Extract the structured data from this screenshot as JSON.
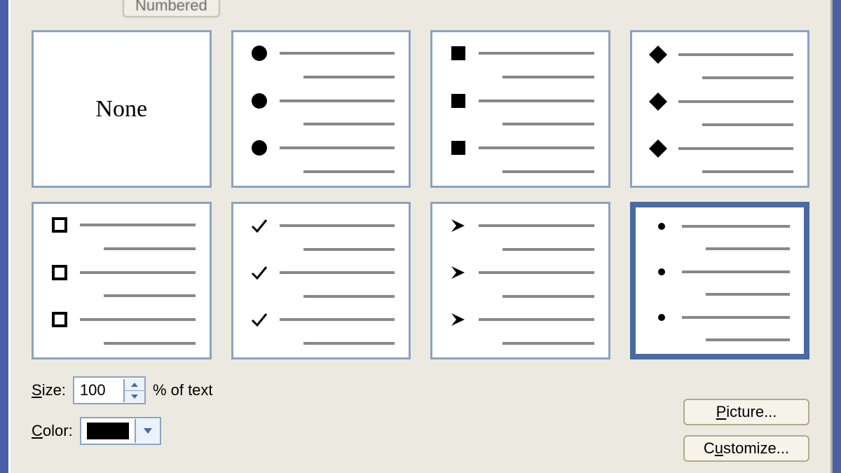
{
  "tabs": {
    "inactive_label": "Numbered"
  },
  "tiles": {
    "none": "None",
    "selected_index": 7,
    "styles": [
      "none",
      "disc",
      "square",
      "diamond",
      "hollow-square",
      "check",
      "arrow",
      "small-dot"
    ]
  },
  "size": {
    "label_u": "S",
    "label_rest": "ize:",
    "value": "100",
    "suffix": "% of text"
  },
  "color": {
    "label_u": "C",
    "label_rest": "olor:",
    "swatch": "#000000"
  },
  "buttons": {
    "picture_u": "P",
    "picture_rest": "icture...",
    "customize_rest": "C",
    "customize_u": "u",
    "customize_rest2": "stomize..."
  }
}
